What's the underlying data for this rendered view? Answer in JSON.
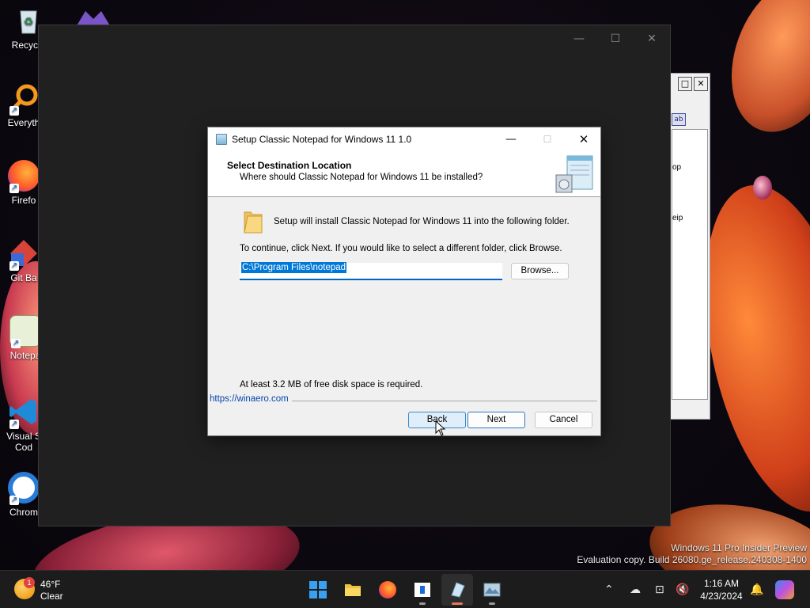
{
  "desktop": {
    "icons": [
      {
        "label": "Recycle",
        "icon": "recycle-bin-icon"
      },
      {
        "label": "Everyth",
        "icon": "everything-search-icon"
      },
      {
        "label": "Firefo",
        "icon": "firefox-icon"
      },
      {
        "label": "Git Ba",
        "icon": "git-bash-icon"
      },
      {
        "label": "Notepa",
        "icon": "notepad-icon"
      },
      {
        "label": "Visual S\nCod",
        "icon": "vscode-icon"
      },
      {
        "label": "Chrom",
        "icon": "chrome-icon"
      }
    ]
  },
  "background_window": {
    "pane_texts": [
      "op",
      "eip"
    ]
  },
  "dialog": {
    "title": "Setup Classic Notepad for Windows 11 1.0",
    "header_title": "Select Destination Location",
    "header_subtitle": "Where should Classic Notepad for Windows 11 be installed?",
    "install_message": "Setup will install Classic Notepad for Windows 11 into the following folder.",
    "continue_message": "To continue, click Next. If you would like to select a different folder, click Browse.",
    "path_value": "C:\\Program Files\\notepad",
    "browse_label": "Browse...",
    "space_required": "At least 3.2 MB of free disk space is required.",
    "link": "https://winaero.com",
    "back_label": "Back",
    "next_label": "Next",
    "cancel_label": "Cancel"
  },
  "watermark": {
    "line1": "Windows 11 Pro Insider Preview",
    "line2": "Evaluation copy. Build 26080.ge_release.240308-1400"
  },
  "taskbar": {
    "weather_badge": "1",
    "temperature": "46°F",
    "condition": "Clear",
    "time": "1:16 AM",
    "date": "4/23/2024"
  }
}
